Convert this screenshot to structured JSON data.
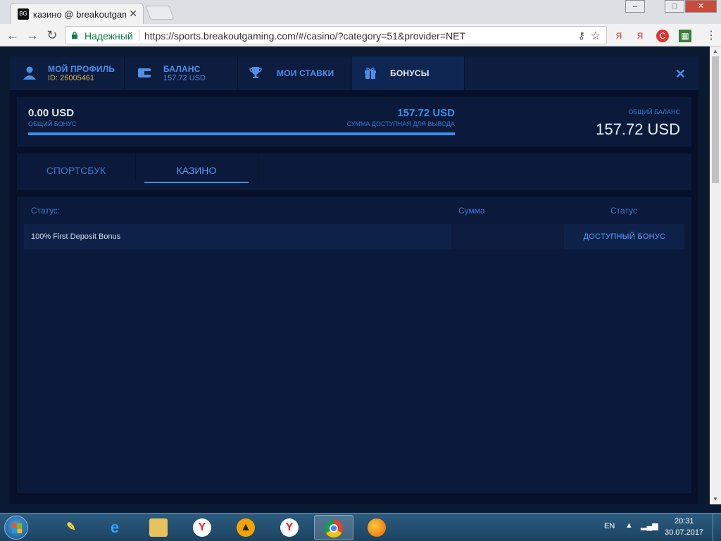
{
  "browser": {
    "tab_title": "казино @ breakoutgaming",
    "tab_favicon": "BG",
    "tab_close": "✕",
    "secure_label": "Надежный",
    "url": "https://sports.breakoutgaming.com/#/casino/?category=51&provider=NET",
    "extensions": [
      "Я",
      "Я"
    ]
  },
  "account_tabs": [
    {
      "title": "МОЙ ПРОФИЛЬ",
      "subtitle": "ID: 26005461",
      "icon": "user-icon"
    },
    {
      "title": "БАЛАНС",
      "subtitle": "157.72 USD",
      "icon": "wallet-icon"
    },
    {
      "title": "МОИ СТАВКИ",
      "icon": "trophy-icon"
    },
    {
      "title": "БОНУСЫ",
      "icon": "gift-icon",
      "active": true
    }
  ],
  "balance": {
    "bonus_value": "0.00 USD",
    "bonus_label": "ОБЩИЙ БОНУС",
    "withdrawable_value": "157.72 USD",
    "withdrawable_label": "СУММА ДОСТУПНАЯ ДЛЯ ВЫВОДА",
    "progress_fraction": 1.0,
    "total_label": "ОБЩИЙ БАЛАНС",
    "total_value": "157.72 USD"
  },
  "sub_tabs": [
    {
      "label": "СПОРТСБУК"
    },
    {
      "label": "КАЗИНО",
      "active": true
    }
  ],
  "bonus_table": {
    "headers": [
      "Статус:",
      "Сумма",
      "Статус"
    ],
    "rows": [
      {
        "name": "100% First Deposit Bonus",
        "amount": "",
        "status": "ДОСТУПНЫЙ БОНУС"
      }
    ]
  },
  "taskbar": {
    "language": "EN",
    "time": "20:31",
    "date": "30.07.2017"
  },
  "colors": {
    "accent": "#3b8fef",
    "label_blue": "#3f78cf",
    "background": "#061129",
    "gold": "#d8b255"
  }
}
